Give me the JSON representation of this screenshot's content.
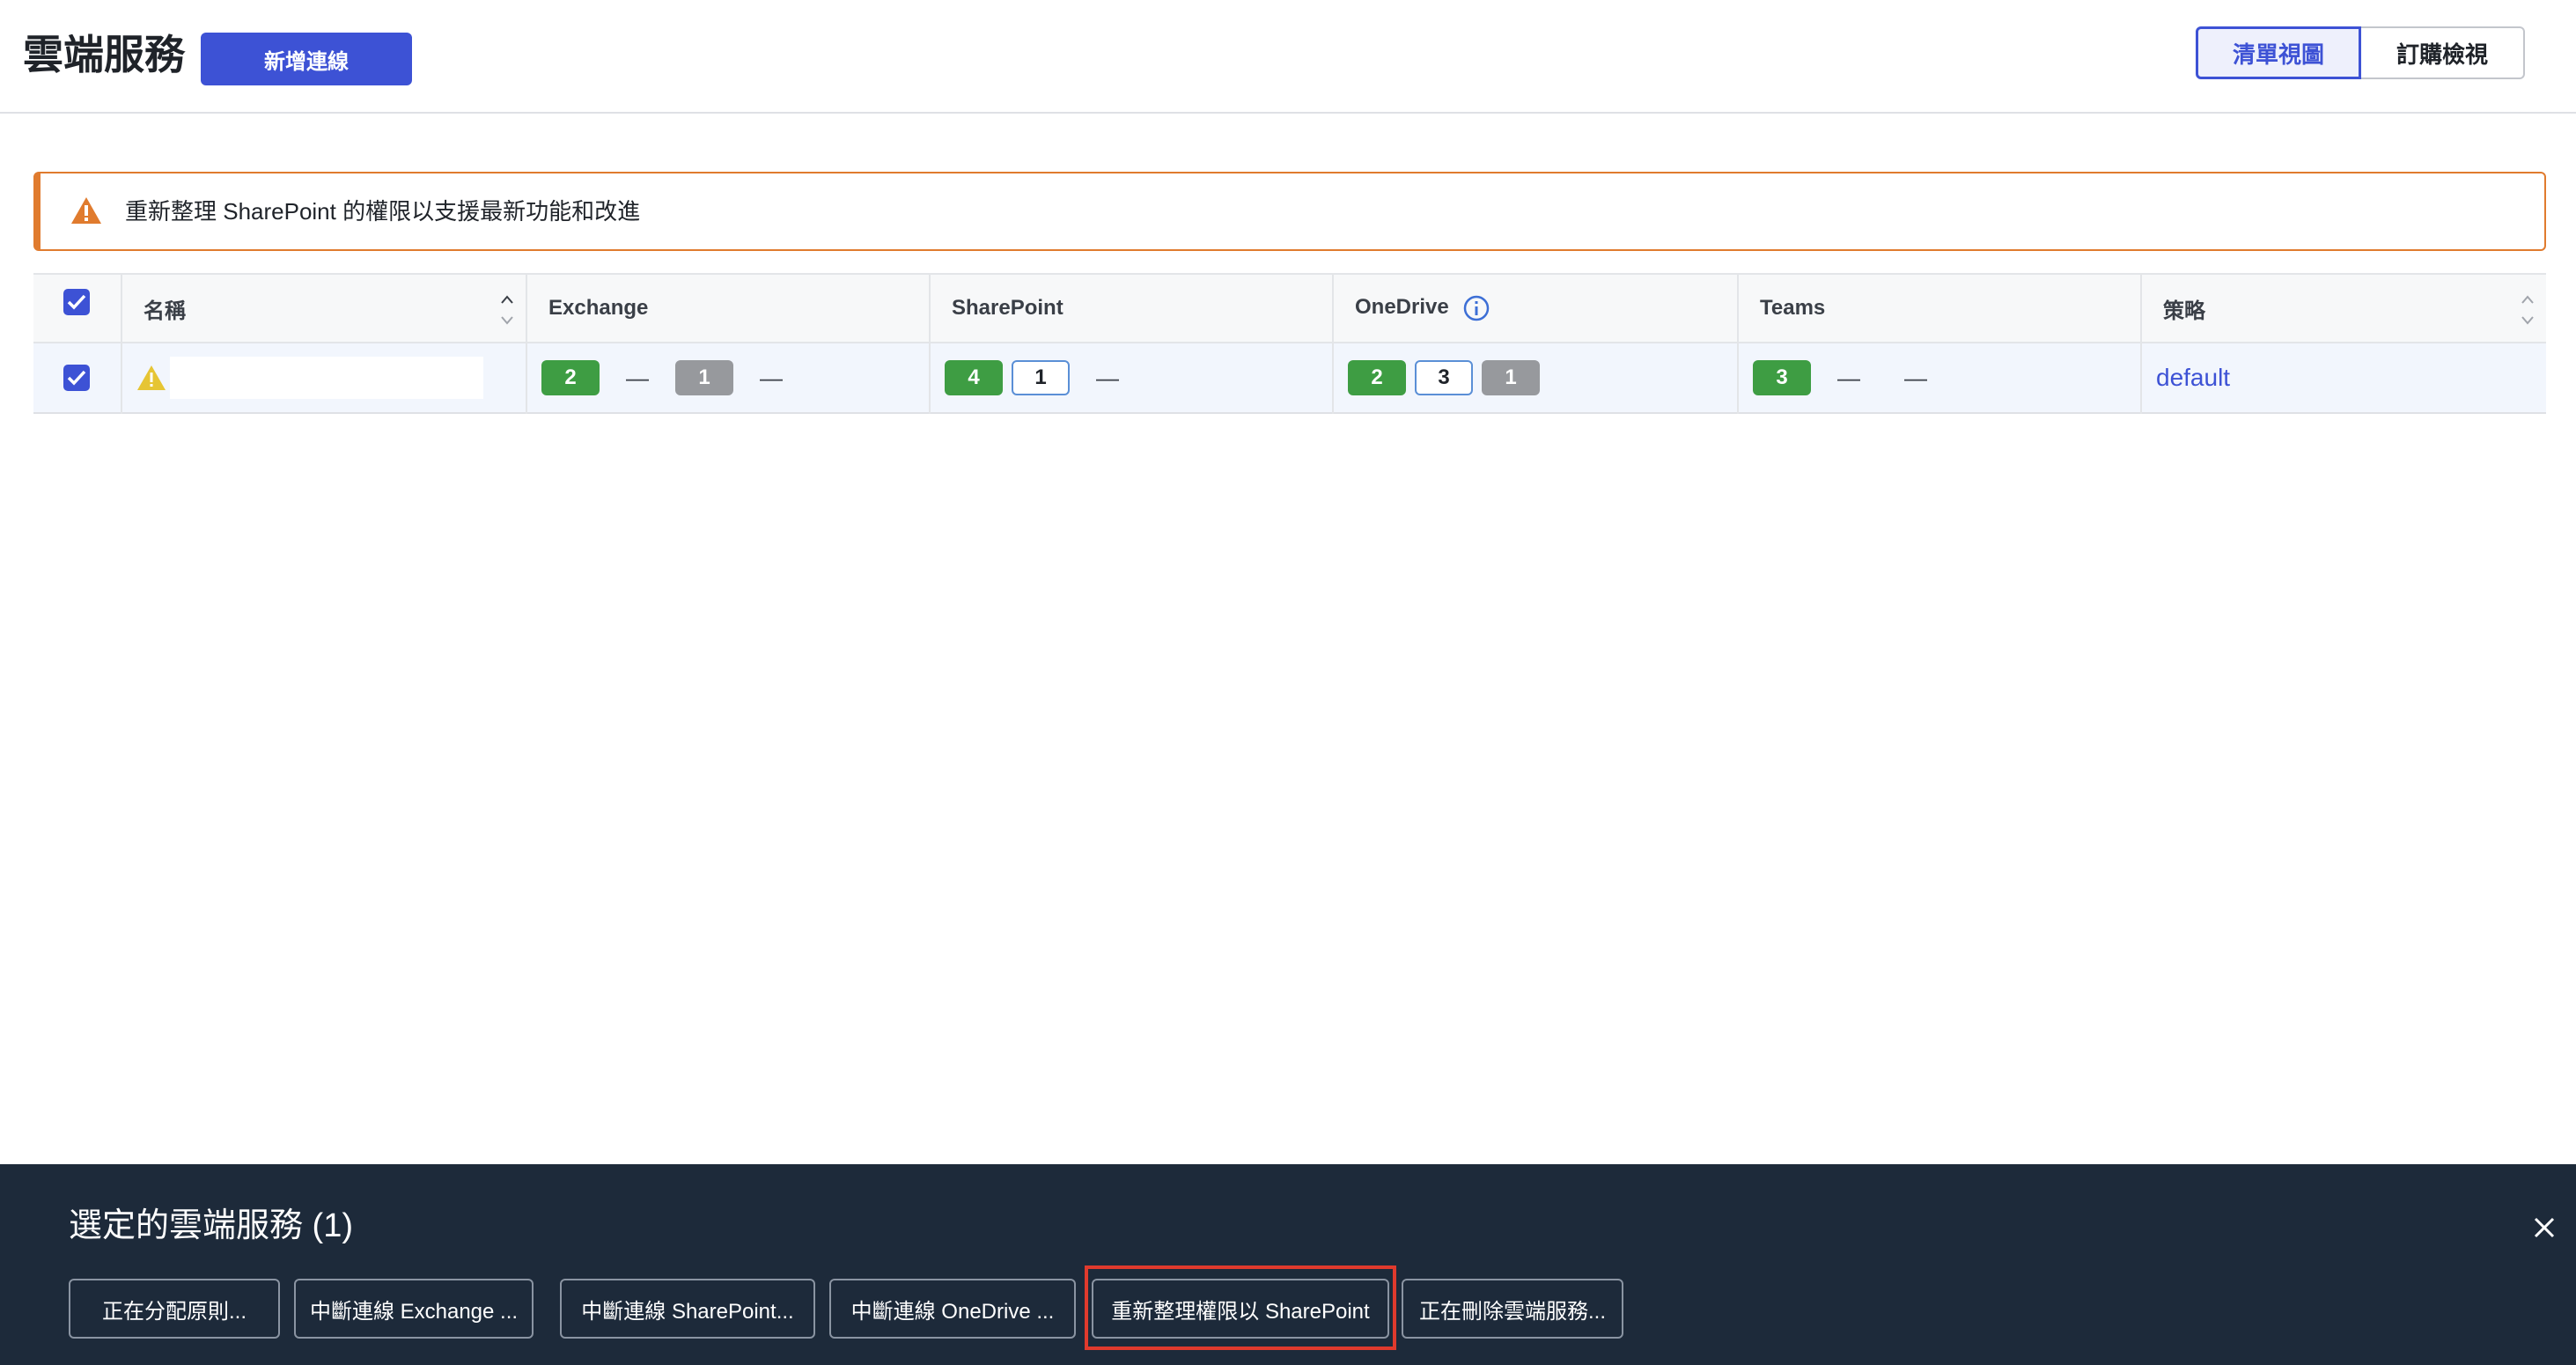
{
  "header": {
    "title": "雲端服務",
    "add_connection_label": "新增連線",
    "view_list_label": "清單視圖",
    "view_subscription_label": "訂購檢視"
  },
  "banner": {
    "text": "重新整理 SharePoint 的權限以支援最新功能和改進",
    "icon": "warning-triangle-icon",
    "color": "#e07b2e"
  },
  "table": {
    "columns": {
      "name": "名稱",
      "exchange": "Exchange",
      "sharepoint": "SharePoint",
      "onedrive": "OneDrive",
      "teams": "Teams",
      "policy": "策略"
    },
    "rows": [
      {
        "selected": true,
        "warning": true,
        "name": "",
        "exchange": {
          "green": "2",
          "dash1": "—",
          "gray": "1",
          "dash2": "—"
        },
        "sharepoint": {
          "green": "4",
          "outline": "1",
          "dash": "—"
        },
        "onedrive": {
          "green": "2",
          "outline": "3",
          "gray": "1"
        },
        "teams": {
          "green": "3",
          "dash1": "—",
          "dash2": "—"
        },
        "policy": "default"
      }
    ]
  },
  "action_bar": {
    "title": "選定的雲端服務 (1)",
    "buttons": [
      "正在分配原則...",
      "中斷連線 Exchange ...",
      "中斷連線 SharePoint...",
      "中斷連線 OneDrive ...",
      "重新整理權限以 SharePoint",
      "正在刪除雲端服務..."
    ]
  },
  "colors": {
    "primary": "#3d52d5",
    "badge_green": "#3e9d43",
    "badge_gray": "#97999d",
    "action_bar_bg": "#1d2a3a",
    "highlight": "#e03a2d"
  }
}
